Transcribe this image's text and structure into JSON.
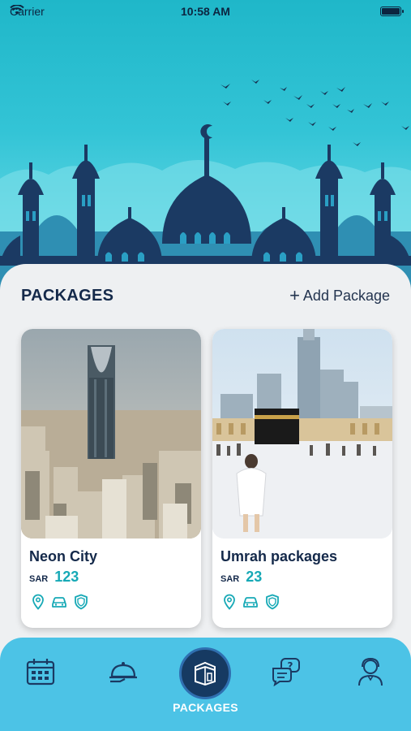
{
  "status_bar": {
    "carrier": "Carrier",
    "time": "10:58 AM"
  },
  "header": {
    "title": "PACKAGES",
    "add_plus": "+",
    "add_label": "Add Package"
  },
  "packages": [
    {
      "title": "Neon City",
      "currency": "SAR",
      "price": "123",
      "features": [
        "location-pin-icon",
        "car-icon",
        "shield-icon"
      ]
    },
    {
      "title": "Umrah packages",
      "currency": "SAR",
      "price": "23",
      "features": [
        "location-pin-icon",
        "car-icon",
        "shield-icon"
      ]
    }
  ],
  "tabbar": {
    "items": [
      "calendar-icon",
      "room-service-icon",
      "kaaba-icon",
      "help-chat-icon",
      "support-agent-icon"
    ],
    "active_label": "PACKAGES"
  },
  "colors": {
    "accent": "#17a9b6",
    "navy": "#14294a",
    "tabbar": "#4cc3e6"
  }
}
